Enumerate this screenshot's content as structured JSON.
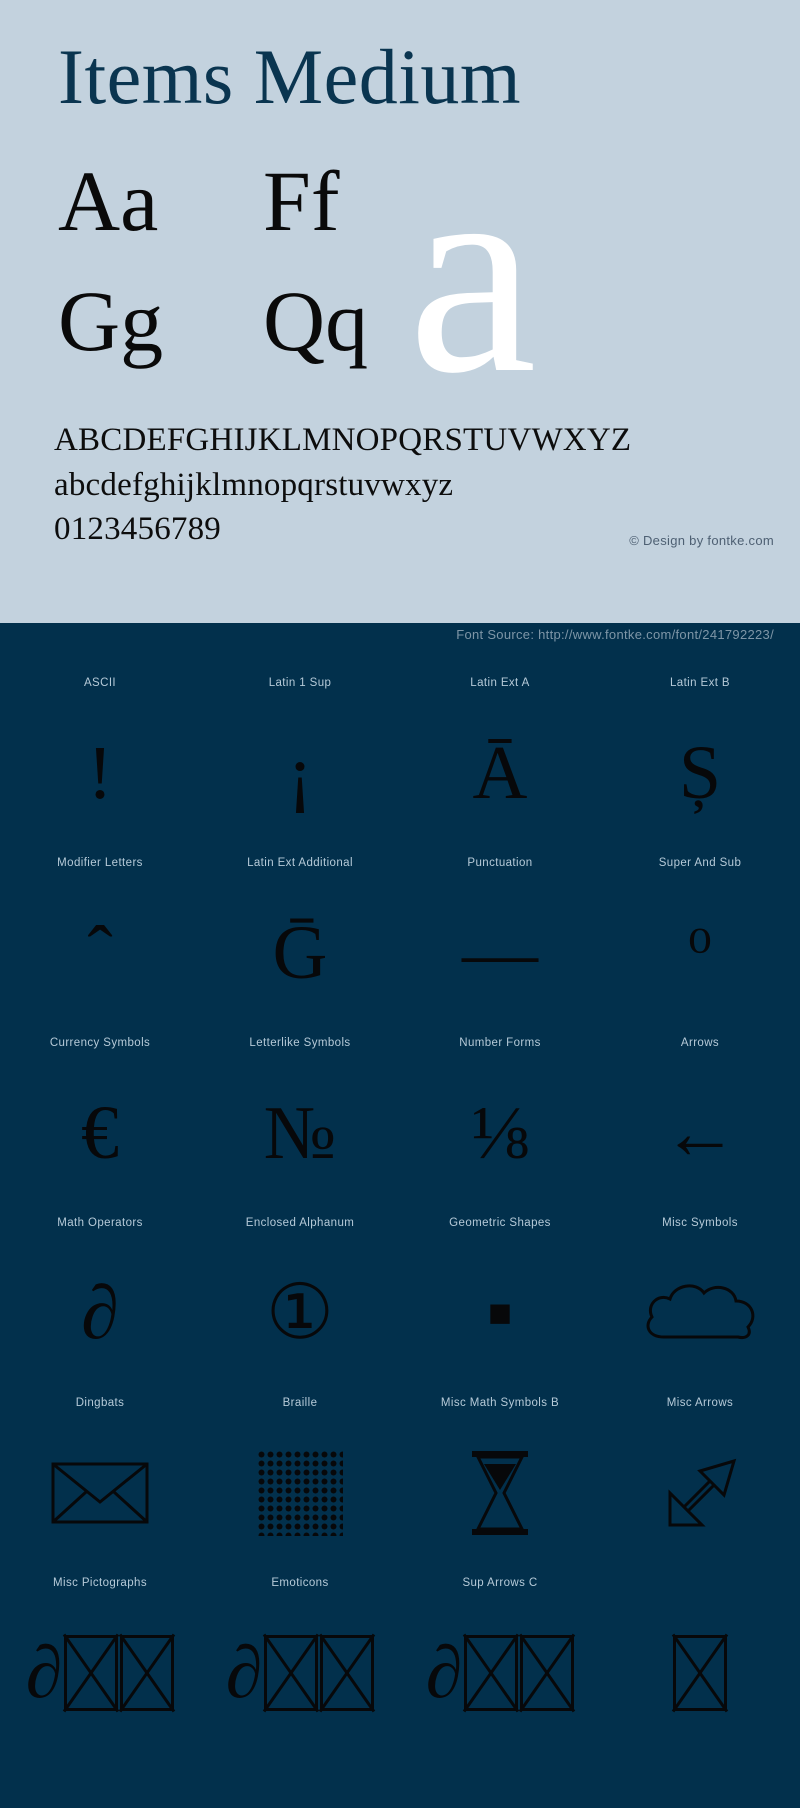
{
  "specimen": {
    "title": "Items Medium",
    "letter_pairs": [
      "Aa",
      "Ff",
      "Gg",
      "Qq"
    ],
    "feature_char": "a",
    "alphabet_uppercase": "ABCDEFGHIJKLMNOPQRSTUVWXYZ",
    "alphabet_lowercase": "abcdefghijklmnopqrstuvwxyz",
    "digits": "0123456789",
    "copyright": "© Design by fontke.com",
    "source_label": "Font Source: http://www.fontke.com/font/241792223/",
    "colors": {
      "top_background": "#c3d2de",
      "title_text": "#0a3550",
      "sample_text": "#0d0d0d",
      "feature_char": "#ffffff",
      "dark_background": "#02304c",
      "block_label": "#b6cad8",
      "source_text": "#7e96a7",
      "copyright_text": "#4e6073"
    }
  },
  "unicode_blocks": [
    [
      {
        "label": "ASCII",
        "glyph": "!",
        "size": "normal",
        "kind": "text"
      },
      {
        "label": "Latin 1 Sup",
        "glyph": "¡",
        "size": "normal",
        "kind": "text"
      },
      {
        "label": "Latin Ext A",
        "glyph": "Ā",
        "size": "normal",
        "kind": "text"
      },
      {
        "label": "Latin Ext B",
        "glyph": "Ș",
        "size": "normal",
        "kind": "text"
      }
    ],
    [
      {
        "label": "Modifier Letters",
        "glyph": "ˆ",
        "size": "normal",
        "kind": "text"
      },
      {
        "label": "Latin Ext Additional",
        "glyph": "Ḡ",
        "size": "normal",
        "kind": "text"
      },
      {
        "label": "Punctuation",
        "glyph": "—",
        "size": "normal",
        "kind": "text"
      },
      {
        "label": "Super And Sub",
        "glyph": "⁰",
        "size": "small",
        "kind": "text"
      }
    ],
    [
      {
        "label": "Currency Symbols",
        "glyph": "€",
        "size": "normal",
        "kind": "text"
      },
      {
        "label": "Letterlike Symbols",
        "glyph": "№",
        "size": "normal",
        "kind": "text"
      },
      {
        "label": "Number Forms",
        "glyph": "⅛",
        "size": "normal",
        "kind": "text"
      },
      {
        "label": "Arrows",
        "glyph": "←",
        "size": "normal",
        "kind": "text"
      }
    ],
    [
      {
        "label": "Math Operators",
        "glyph": "∂",
        "size": "normal",
        "kind": "text"
      },
      {
        "label": "Enclosed Alphanum",
        "glyph": "①",
        "size": "normal",
        "kind": "text"
      },
      {
        "label": "Geometric Shapes",
        "glyph": "■",
        "size": "tiny",
        "kind": "text"
      },
      {
        "label": "Misc Symbols",
        "glyph": "☁",
        "size": "normal",
        "kind": "cloud"
      }
    ],
    [
      {
        "label": "Dingbats",
        "glyph": "✉",
        "size": "normal",
        "kind": "envelope"
      },
      {
        "label": "Braille",
        "glyph": "⣿",
        "size": "normal",
        "kind": "braille"
      },
      {
        "label": "Misc Math Symbols B",
        "glyph": "⧖",
        "size": "normal",
        "kind": "hourglass"
      },
      {
        "label": "Misc Arrows",
        "glyph": "⬀",
        "size": "normal",
        "kind": "arrow-ne"
      }
    ],
    [
      {
        "label": "Misc Pictographs",
        "glyph": "∂",
        "size": "normal",
        "kind": "tofu-pair"
      },
      {
        "label": "Emoticons",
        "glyph": "∂",
        "size": "normal",
        "kind": "tofu-pair"
      },
      {
        "label": "Sup Arrows C",
        "glyph": "∂",
        "size": "normal",
        "kind": "tofu-pair"
      },
      {
        "label": "",
        "glyph": "",
        "size": "normal",
        "kind": "tofu-single"
      }
    ]
  ]
}
